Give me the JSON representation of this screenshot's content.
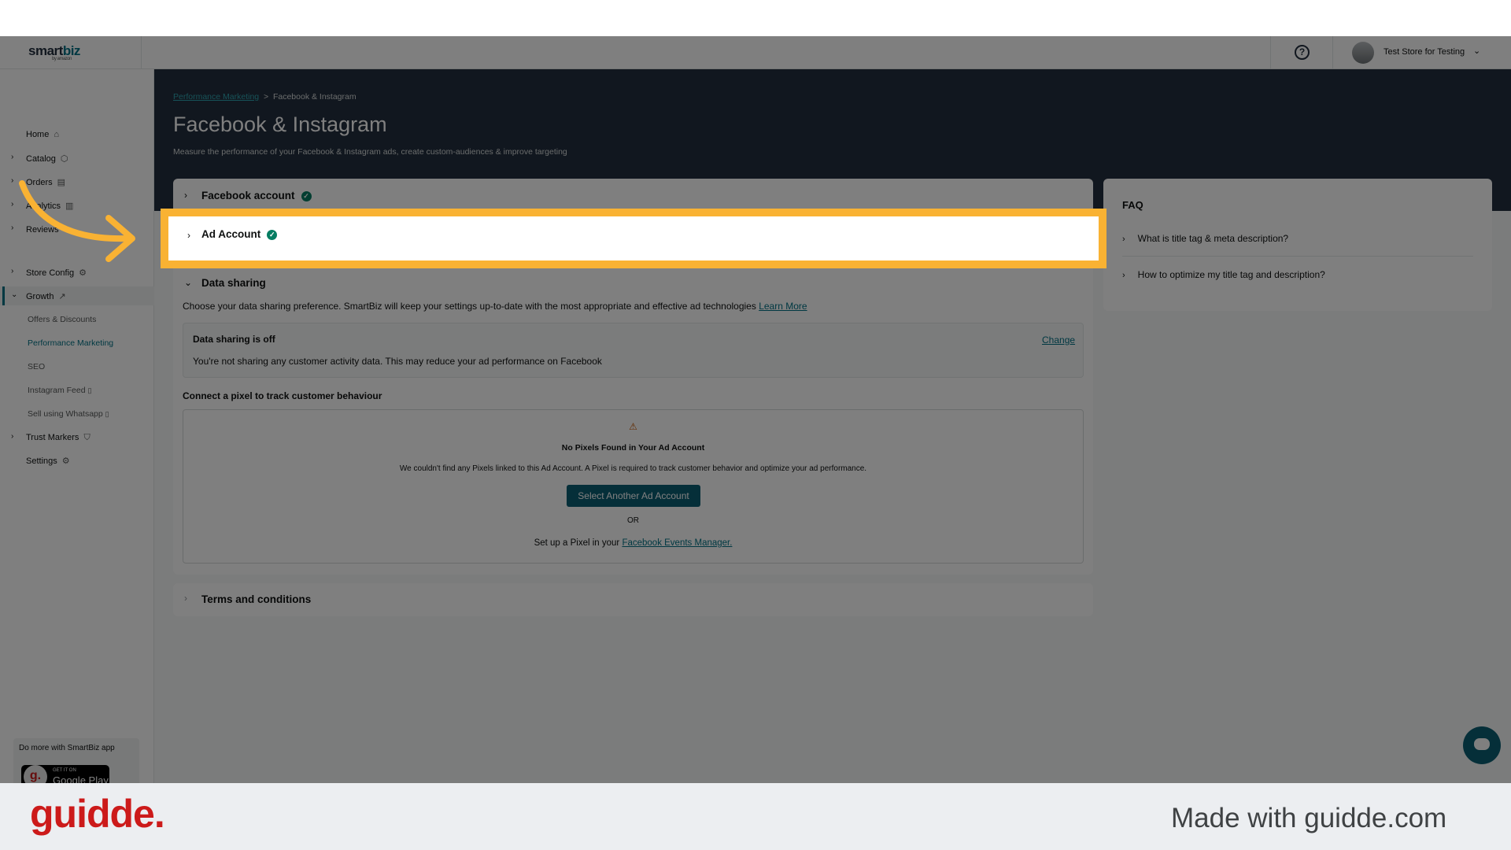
{
  "app": {
    "logo_main": "smart",
    "logo_accent": "biz",
    "logo_sub": "by amazon",
    "store_name": "Test Store for Testing"
  },
  "sidebar": {
    "items": [
      {
        "label": "Home",
        "icon": "home-icon"
      },
      {
        "label": "Catalog",
        "icon": "box-icon"
      },
      {
        "label": "Orders",
        "icon": "clipboard-icon"
      },
      {
        "label": "Analytics",
        "icon": "bar-chart-icon"
      },
      {
        "label": "Reviews",
        "icon": "star-icon"
      },
      {
        "label": "Store Config",
        "icon": "gear-icon"
      },
      {
        "label": "Growth",
        "icon": "trend-icon"
      },
      {
        "label": "Trust Markers",
        "icon": "shield-icon"
      },
      {
        "label": "Settings",
        "icon": "gear-icon"
      }
    ],
    "growth_sub": [
      "Offers & Discounts",
      "Performance Marketing",
      "SEO",
      "Instagram Feed",
      "Sell using Whatsapp"
    ],
    "promo_text": "Do more with SmartBiz app",
    "gplay_small": "GET IT ON",
    "gplay_big": "Google Play",
    "guidde_badge": "g."
  },
  "main": {
    "breadcrumb_link": "Performance Marketing",
    "breadcrumb_sep": ">",
    "breadcrumb_current": "Facebook & Instagram",
    "title": "Facebook & Instagram",
    "description": "Measure the performance of your Facebook & Instagram ads, create custom-audiences & improve targeting"
  },
  "setup": {
    "facebook_account": "Facebook account",
    "ad_account": "Ad Account",
    "data_sharing": {
      "title": "Data sharing",
      "desc": "Choose your data sharing preference. SmartBiz will keep your settings up-to-date with the most appropriate and effective ad technologies",
      "learn_more": "Learn More",
      "box_title": "Data sharing is off",
      "box_text": "You're not sharing any customer activity data. This may reduce your ad performance on Facebook",
      "change": "Change"
    },
    "pixel": {
      "title": "Connect a pixel to track customer behaviour",
      "warning": "⚠",
      "none_title": "No Pixels Found in Your Ad Account",
      "none_text": "We couldn't find any Pixels linked to this Ad Account. A Pixel is required to track customer behavior and optimize your ad performance.",
      "button": "Select Another Ad Account",
      "or": "OR",
      "setup_text": "Set up a Pixel in your",
      "setup_link": "Facebook Events Manager."
    },
    "terms": "Terms and conditions"
  },
  "faq": {
    "title": "FAQ",
    "items": [
      "What is title tag & meta description?",
      "How to optimize my title tag and description?"
    ]
  },
  "colors": {
    "highlight": "#f9b233",
    "accent": "#007185",
    "button": "#0b5e73",
    "success": "#067d62",
    "guidde_red": "#cc1a1a"
  },
  "footer": {
    "brand": "guidde.",
    "made_with": "Made with guidde.com"
  }
}
